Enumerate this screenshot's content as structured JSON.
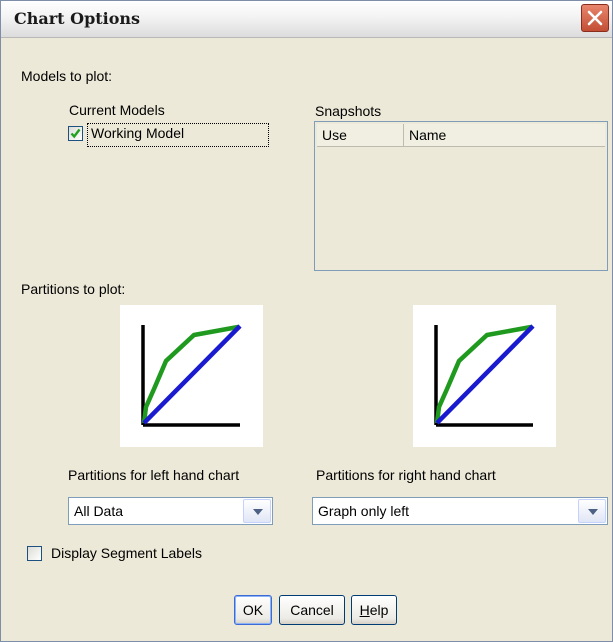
{
  "window": {
    "title": "Chart Options"
  },
  "models": {
    "section_label": "Models to plot:",
    "current_label": "Current Models",
    "working_model_label": "Working Model",
    "working_model_checked": true,
    "snapshots_label": "Snapshots",
    "snapshot_columns": [
      "Use",
      "Name"
    ]
  },
  "partitions": {
    "section_label": "Partitions to plot:",
    "left_label": "Partitions for left hand chart",
    "left_value": "All Data",
    "right_label": "Partitions for right hand chart",
    "right_value": "Graph only left"
  },
  "segment_labels": {
    "label": "Display Segment Labels",
    "checked": false
  },
  "buttons": {
    "ok": "OK",
    "cancel": "Cancel",
    "help_prefix": "",
    "help_mnemonic": "H",
    "help_rest": "elp"
  },
  "colors": {
    "green_curve": "#1f9a1f",
    "blue_diagonal": "#1a1acf",
    "axis": "#000000"
  },
  "icons": {
    "close": "close-icon",
    "check": "checkmark-icon",
    "dropdown": "chevron-down-icon"
  }
}
